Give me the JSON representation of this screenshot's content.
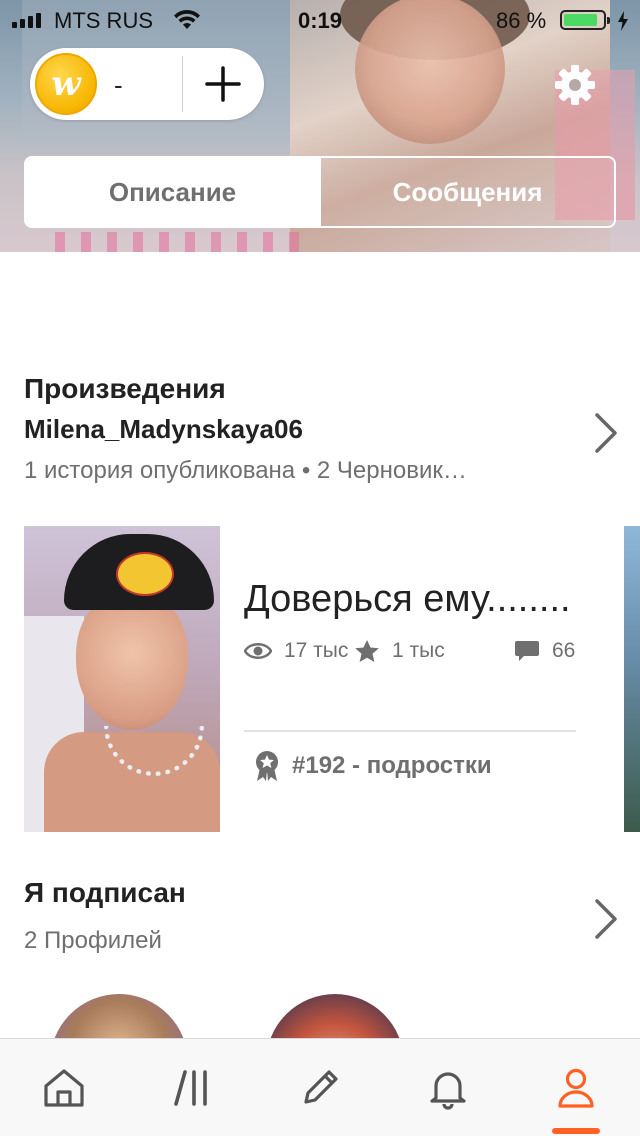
{
  "status_bar": {
    "carrier": "MTS RUS",
    "time": "0:19",
    "battery_percent": "86 %",
    "battery_level": 0.86
  },
  "coins": {
    "logo_letter": "w",
    "count": "-"
  },
  "tabs": [
    {
      "label": "Описание",
      "active": true
    },
    {
      "label": "Сообщения",
      "active": false
    }
  ],
  "works": {
    "title": "Произведения",
    "username": "Milena_Madynskaya06",
    "meta": "1 история опубликована • 2 Черновик…"
  },
  "story": {
    "title": "Доверься ему........",
    "reads": "17 тыс",
    "votes": "1 тыс",
    "comments": "66",
    "rank": "#192 - подростки"
  },
  "following": {
    "title": "Я подписан",
    "count_text": "2 Профилей"
  },
  "nav": {
    "items": [
      "home",
      "library",
      "write",
      "notifications",
      "profile"
    ],
    "active": "profile"
  },
  "colors": {
    "accent": "#ff6122",
    "coin": "#f7b500",
    "text_primary": "#222222",
    "text_secondary": "#6f6f6f"
  }
}
